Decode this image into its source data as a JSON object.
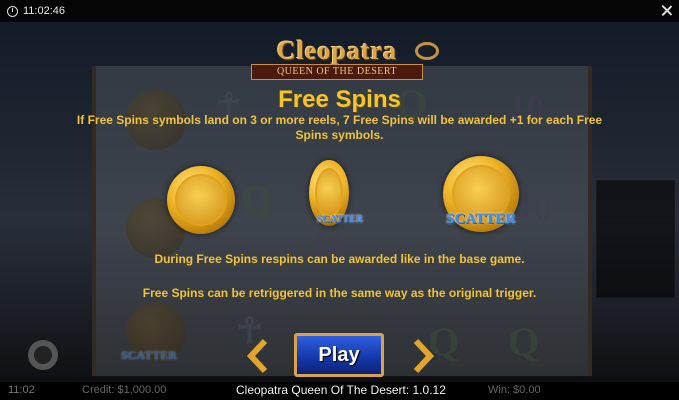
{
  "topbar": {
    "time": "11:02:46"
  },
  "logo": {
    "main": "Cleopatra",
    "sub": "QUEEN OF THE DESERT"
  },
  "help": {
    "title": "Free Spins",
    "description": "If Free Spins symbols land on 3 or more reels, 7 Free Spins will be awarded +1 for each Free Spins symbols.",
    "scatter_label": "SCATTER",
    "note_respins": "During Free Spins respins can be awarded like in the base game.",
    "note_retrigger": "Free Spins can be retriggered in the same way as the original trigger."
  },
  "background": {
    "time": "11:02",
    "credit": "Credit: $1,000.00",
    "win": "Win: $0.00"
  },
  "controls": {
    "play_label": "Play"
  },
  "footer": {
    "game_version": "Cleopatra Queen Of The Desert: 1.0.12"
  },
  "colors": {
    "accent": "#f5c52a",
    "play": "#1f4bd0",
    "scatter": "#3a8df0"
  },
  "icons": [
    "clock-icon",
    "close-icon",
    "gear-icon",
    "chevron-left-icon",
    "chevron-right-icon"
  ]
}
